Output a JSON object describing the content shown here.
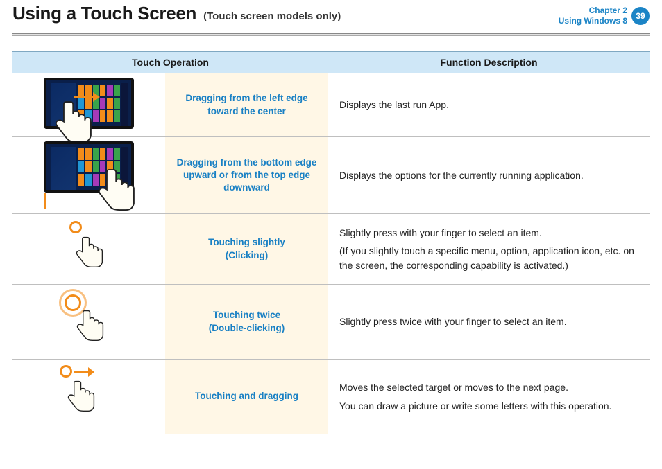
{
  "header": {
    "title": "Using a Touch Screen",
    "subtitle": "(Touch screen models only)",
    "chapter_line1": "Chapter 2",
    "chapter_line2": "Using Windows 8",
    "page_number": "39"
  },
  "table": {
    "headers": {
      "touch_operation": "Touch Operation",
      "function_description": "Function Description"
    },
    "rows": [
      {
        "operation": "Dragging from the left edge toward the center",
        "description": [
          "Displays the last run App."
        ]
      },
      {
        "operation": "Dragging from the bottom edge upward or from the top edge downward",
        "description": [
          "Displays the options for the currently running application."
        ]
      },
      {
        "operation_line1": "Touching slightly",
        "operation_line2": "(Clicking)",
        "description": [
          "Slightly press with your finger to select an item.",
          "(If you slightly touch a specific menu, option, application icon, etc. on the screen, the corresponding capability is activated.)"
        ]
      },
      {
        "operation_line1": "Touching twice",
        "operation_line2": "(Double-clicking)",
        "description": [
          "Slightly press twice with your finger to select an item."
        ]
      },
      {
        "operation": "Touching and dragging",
        "description": [
          "Moves the selected target or moves to the next page.",
          "You can draw a picture or write some letters with this operation."
        ]
      }
    ]
  }
}
